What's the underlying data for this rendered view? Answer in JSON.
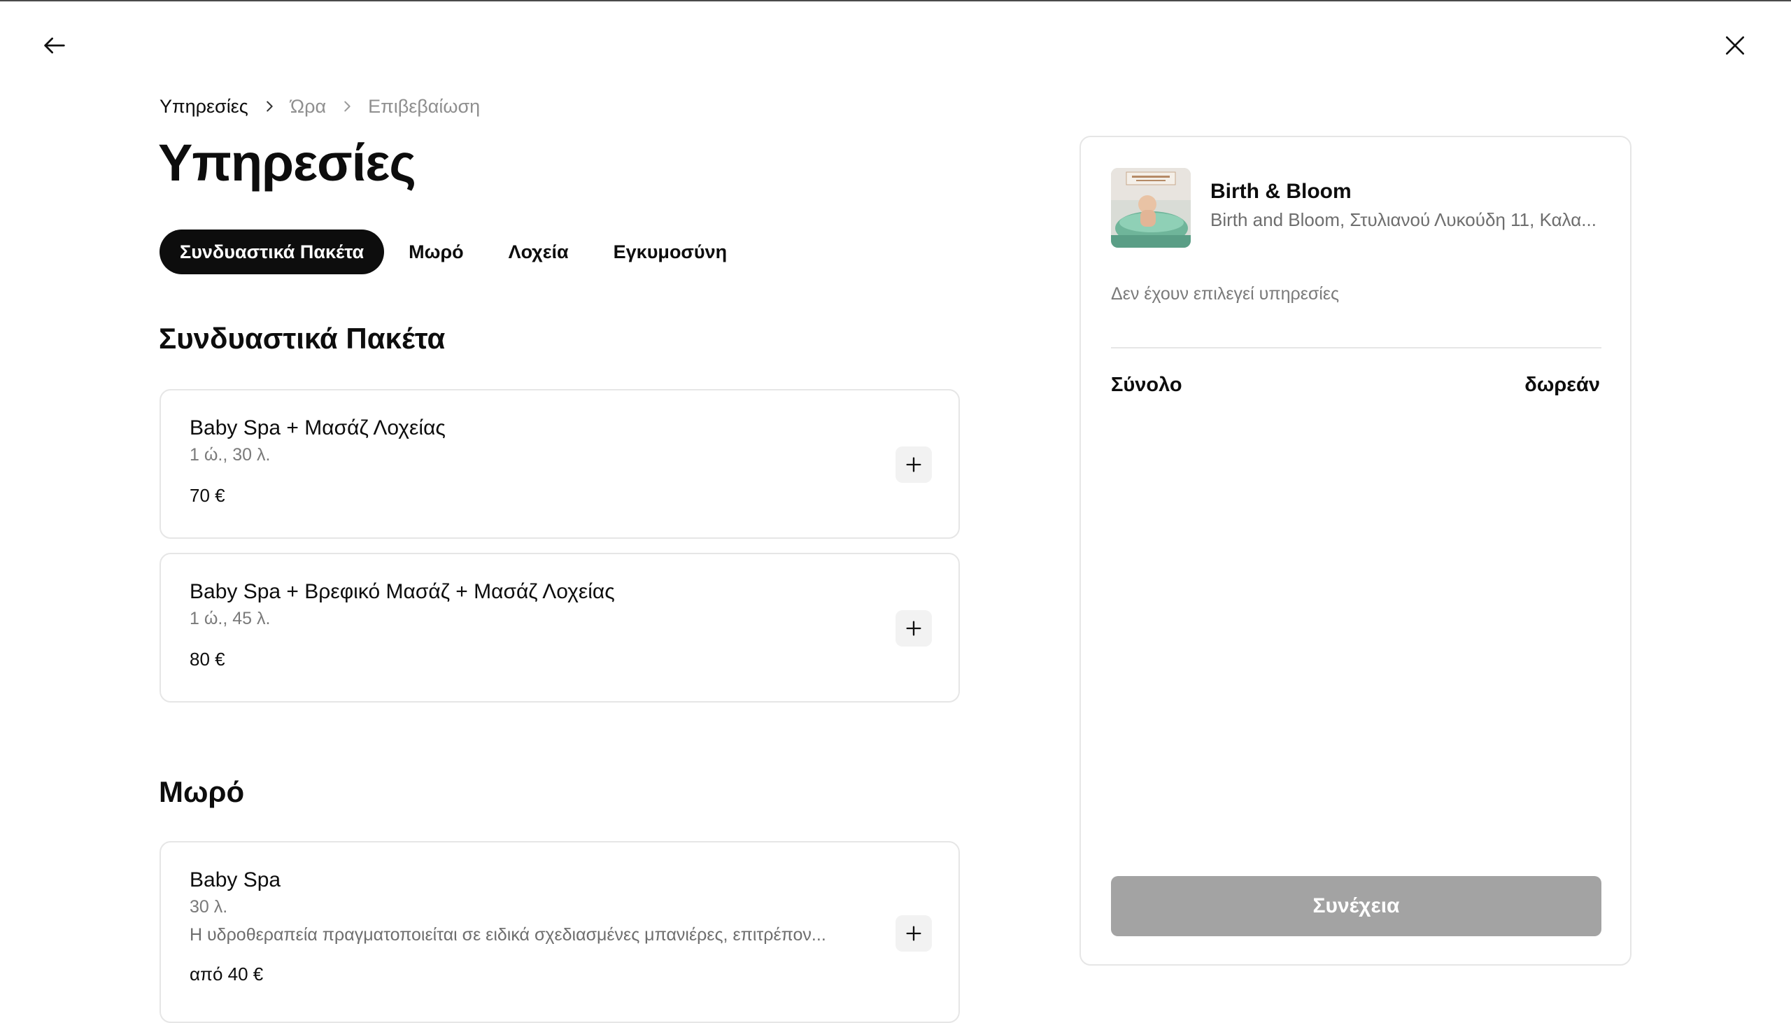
{
  "breadcrumb": {
    "items": [
      {
        "label": "Υπηρεσίες",
        "active": true
      },
      {
        "label": "Ώρα",
        "active": false
      },
      {
        "label": "Επιβεβαίωση",
        "active": false
      }
    ]
  },
  "page_title": "Υπηρεσίες",
  "tabs": [
    {
      "label": "Συνδυαστικά Πακέτα",
      "active": true
    },
    {
      "label": "Μωρό",
      "active": false
    },
    {
      "label": "Λοχεία",
      "active": false
    },
    {
      "label": "Εγκυμοσύνη",
      "active": false
    }
  ],
  "sections": [
    {
      "title": "Συνδυαστικά Πακέτα",
      "services": [
        {
          "name": "Baby Spa + Μασάζ Λοχείας",
          "duration": "1 ώ., 30 λ.",
          "price": "70 €"
        },
        {
          "name": "Baby Spa + Βρεφικό Μασάζ + Μασάζ Λοχείας",
          "duration": "1 ώ., 45 λ.",
          "price": "80 €"
        }
      ]
    },
    {
      "title": "Μωρό",
      "services": [
        {
          "name": "Baby Spa",
          "duration": "30 λ.",
          "description": "Η υδροθεραπεία πραγματοποιείται σε ειδικά σχεδιασμένες μπανιέρες, επιτρέπον...",
          "price": "από 40 €"
        }
      ]
    }
  ],
  "summary": {
    "venue_name": "Birth & Bloom",
    "venue_address": "Birth and Bloom, Στυλιανού Λυκούδη 11, Καλα...",
    "empty_note": "Δεν έχουν επιλεγεί υπηρεσίες",
    "total_label": "Σύνολο",
    "total_value": "δωρεάν",
    "continue_label": "Συνέχεια"
  },
  "icons": {
    "back": "arrow-left-icon",
    "close": "close-icon",
    "breadcrumb_separator": "chevron-right-icon",
    "add": "plus-icon"
  },
  "colors": {
    "active_tab_bg": "#0d0d0d",
    "muted_text": "#8f8f8f",
    "card_border": "#e6e6e6",
    "disabled_button": "#a3a3a3"
  }
}
